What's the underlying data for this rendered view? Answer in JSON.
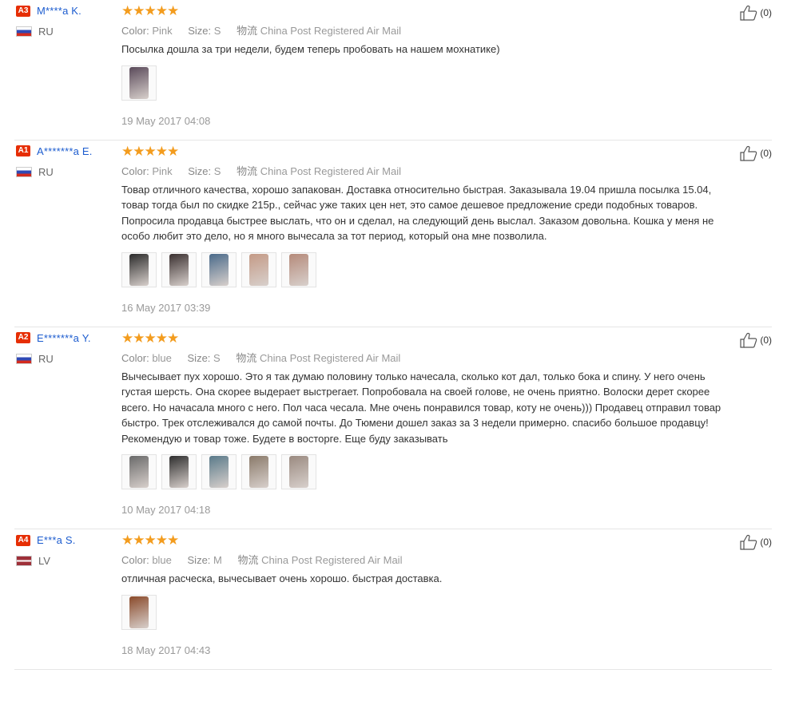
{
  "reviews": [
    {
      "badge": "A3",
      "name": "M****a K.",
      "country": "RU",
      "flag": "ru",
      "stars": "★★★★★",
      "color_label": "Color:",
      "color_value": "Pink",
      "size_label": "Size:",
      "size_value": "S",
      "shipping_label": "物流",
      "shipping_value": "China Post Registered Air Mail",
      "text": "Посылка дошла за три недели, будем теперь пробовать на нашем мохнатике)",
      "photos": [
        {
          "color": "#5a4a5a",
          "icon": "photo-thumbnail"
        }
      ],
      "date": "19 May 2017 04:08",
      "helpful": "(0)"
    },
    {
      "badge": "A1",
      "name": "A*******a E.",
      "country": "RU",
      "flag": "ru",
      "stars": "★★★★★",
      "color_label": "Color:",
      "color_value": "Pink",
      "size_label": "Size:",
      "size_value": "S",
      "shipping_label": "物流",
      "shipping_value": "China Post Registered Air Mail",
      "text": "Товар отличного качества, хорошо запакован. Доставка относительно быстрая. Заказывала 19.04 пришла посылка 15.04, товар тогда был по скидке 215р., сейчас уже таких цен нет, это самое дешевое предложение среди подобных товаров. Попросила продавца быстрее выслать, что он и сделал, на следующий день выслал. Заказом довольна. Кошка у меня не особо любит это дело, но я много вычесала за тот период, который она мне позволила.",
      "photos": [
        {
          "color": "#2b2b2b",
          "icon": "photo-thumbnail"
        },
        {
          "color": "#3a3030",
          "icon": "photo-thumbnail"
        },
        {
          "color": "#4a6a8a",
          "icon": "photo-thumbnail"
        },
        {
          "color": "#c49a86",
          "icon": "photo-thumbnail"
        },
        {
          "color": "#b58a7a",
          "icon": "photo-thumbnail"
        }
      ],
      "date": "16 May 2017 03:39",
      "helpful": "(0)"
    },
    {
      "badge": "A2",
      "name": "E*******a Y.",
      "country": "RU",
      "flag": "ru",
      "stars": "★★★★★",
      "color_label": "Color:",
      "color_value": "blue",
      "size_label": "Size:",
      "size_value": "S",
      "shipping_label": "物流",
      "shipping_value": "China Post Registered Air Mail",
      "text": "Вычесывает пух хорошо. Это я так думаю половину только начесала, сколько кот дал, только бока и спину. У него очень густая шерсть. Она скорее выдерает выстрегает. Попробовала на своей голове, не очень приятно. Волоски дерет скорее всего. Но начасала много с него. Пол часа чесала. Мне очень понравился товар, коту не очень))) Продавец отправил товар быстро. Трек отслеживался до самой почты. До Тюмени дошел заказ за 3 недели примерно. спасибо большое продавцу! Рекомендую и товар тоже. Будете в восторге. Еще буду заказывать",
      "photos": [
        {
          "color": "#6a6a6a",
          "icon": "photo-thumbnail"
        },
        {
          "color": "#2e2e2e",
          "icon": "photo-thumbnail"
        },
        {
          "color": "#5a7a8a",
          "icon": "photo-thumbnail"
        },
        {
          "color": "#8a7a6a",
          "icon": "photo-thumbnail"
        },
        {
          "color": "#9a8a80",
          "icon": "photo-thumbnail"
        }
      ],
      "date": "10 May 2017 04:18",
      "helpful": "(0)"
    },
    {
      "badge": "A4",
      "name": "E***a S.",
      "country": "LV",
      "flag": "lv",
      "stars": "★★★★★",
      "color_label": "Color:",
      "color_value": "blue",
      "size_label": "Size:",
      "size_value": "M",
      "shipping_label": "物流",
      "shipping_value": "China Post Registered Air Mail",
      "text": "отличная расческа, вычесывает очень хорошо. быстрая доставка.",
      "photos": [
        {
          "color": "#8a4a2a",
          "icon": "photo-thumbnail"
        }
      ],
      "date": "18 May 2017 04:43",
      "helpful": "(0)"
    }
  ]
}
